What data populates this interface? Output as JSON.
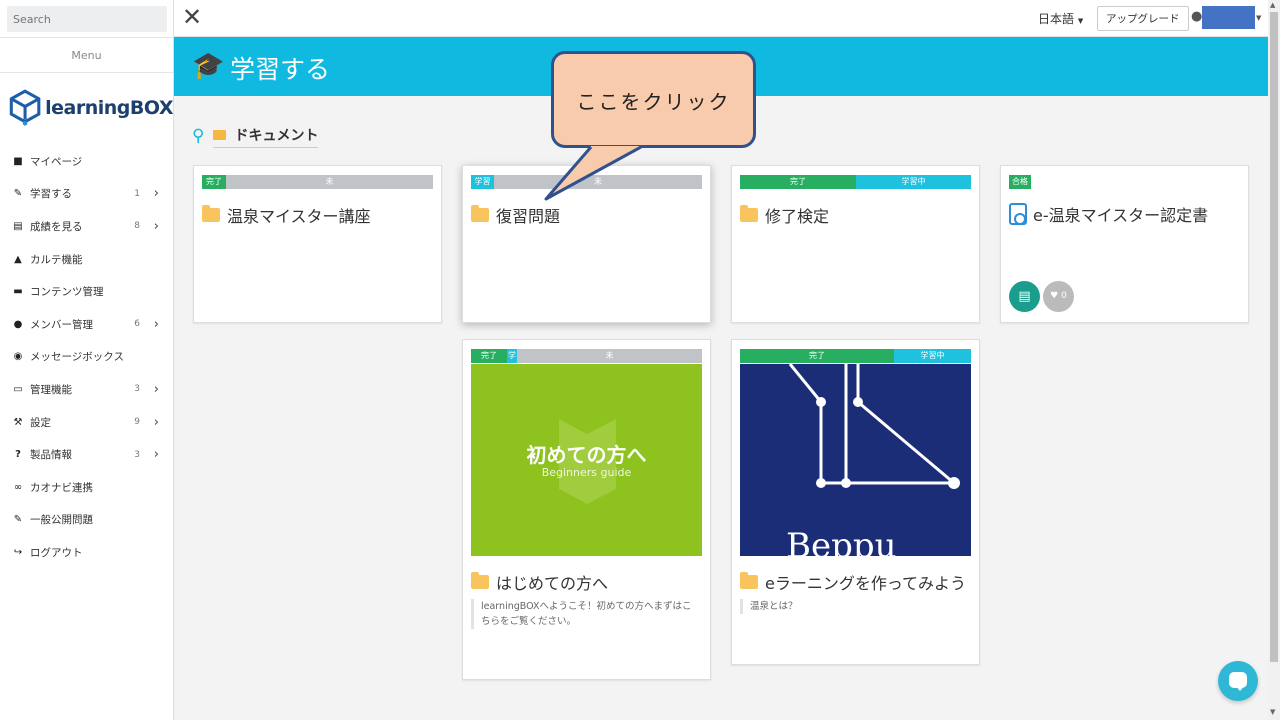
{
  "sidebar": {
    "search_placeholder": "Search",
    "menu_label": "Menu",
    "logo_text": "learningBOX",
    "items": [
      {
        "label": "マイページ",
        "icon": "person-icon",
        "count": "",
        "chevron": false
      },
      {
        "label": "学習する",
        "icon": "pencil-icon",
        "count": "1",
        "chevron": true
      },
      {
        "label": "成績を見る",
        "icon": "chart-icon",
        "count": "8",
        "chevron": true
      },
      {
        "label": "カルテ機能",
        "icon": "analytics-icon",
        "count": "",
        "chevron": false
      },
      {
        "label": "コンテンツ管理",
        "icon": "folder-icon",
        "count": "",
        "chevron": false
      },
      {
        "label": "メンバー管理",
        "icon": "users-icon",
        "count": "6",
        "chevron": true
      },
      {
        "label": "メッセージボックス",
        "icon": "messages-icon",
        "count": "",
        "chevron": false
      },
      {
        "label": "管理機能",
        "icon": "monitor-icon",
        "count": "3",
        "chevron": true
      },
      {
        "label": "設定",
        "icon": "wrench-icon",
        "count": "9",
        "chevron": true
      },
      {
        "label": "製品情報",
        "icon": "question-icon",
        "count": "3",
        "chevron": true
      },
      {
        "label": "カオナビ連携",
        "icon": "link-icon",
        "count": "",
        "chevron": false
      },
      {
        "label": "一般公開問題",
        "icon": "pencil-icon",
        "count": "",
        "chevron": false
      },
      {
        "label": "ログアウト",
        "icon": "logout-icon",
        "count": "",
        "chevron": false
      }
    ]
  },
  "topbar": {
    "language": "日本語",
    "upgrade_label": "アップグレード"
  },
  "header": {
    "title": "学習する"
  },
  "breadcrumb": {
    "item": "ドキュメント"
  },
  "cards": {
    "c1": {
      "title": "温泉マイスター講座",
      "status_done": "完了",
      "status_not": "未"
    },
    "c2": {
      "title": "復習問題",
      "status_learning": "学習",
      "status_not": "未"
    },
    "c3": {
      "title": "修了検定",
      "status_done": "完了",
      "status_learning": "学習中"
    },
    "c4": {
      "title": "e-温泉マイスター認定書",
      "badge": "合格",
      "likes": "0"
    },
    "c5": {
      "title": "はじめての方へ",
      "status_done": "完了",
      "status_learning": "学",
      "status_not": "未",
      "thumb_title": "初めての方へ",
      "thumb_sub": "Beginners guide",
      "description": "learningBOXへようこそ！初めての方へまずはこちらをご覧ください。"
    },
    "c6": {
      "title": "eラーニングを作ってみよう",
      "status_done": "完了",
      "status_learning": "学習中",
      "thumb_text": "Beppu",
      "description": "温泉とは？"
    }
  },
  "callout": {
    "text": "ここをクリック"
  },
  "colors": {
    "accent": "#0fb9e0",
    "done": "#27ae60",
    "learning": "#1ec2df",
    "not_started": "#c0c4c8",
    "folder": "#f8c45e",
    "callout_fill": "#f8cbad",
    "callout_border": "#2f528f"
  }
}
